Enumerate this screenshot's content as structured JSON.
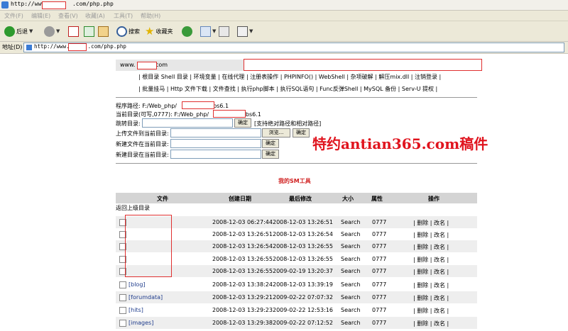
{
  "window": {
    "title_prefix": "http://www.",
    "title_suffix": ".com/php.php"
  },
  "menu": [
    "文件(F)",
    "编辑(E)",
    "查看(V)",
    "收藏(A)",
    "工具(T)",
    "帮助(H)"
  ],
  "toolbar": {
    "back": "后退",
    "search": "搜索",
    "favorites": "收藏夹"
  },
  "address": {
    "label": "地址(D)",
    "url_prefix": "http://www.",
    "url_suffix": ".com/php.php"
  },
  "site": {
    "label_prefix": "www.",
    "label_suffix": ".com"
  },
  "nav": {
    "line1": "| 根目录 Shell 目录 | 环境变量 | 在线代理 | 注册表操作 | PHPINFO() | WebShell | 杂项破解 | 解压mix.dll | 注销登录 |",
    "line2": "| 批量挂马 | Http 文件下载 | 文件查找 | 执行php脚本 | 执行SQL语句 | Func反弹Shell | MySQL 备份 | Serv-U 提权 |"
  },
  "paths": {
    "program_label": "程序路径: F:/Web_php/",
    "program_suffix": "bbs6.1",
    "current_label": "当前目录(可写,0777): F:/Web_php/",
    "current_suffix": "/bbs6.1",
    "jump_label": "跳转目录:",
    "jump_btn": "确定",
    "jump_hint": "[支持绝对路径和相对路径]",
    "upload_label": "上传文件到当前目录:",
    "browse_btn": "浏览...",
    "upload_btn": "确定",
    "newfile_label": "新建文件在当前目录:",
    "newfile_btn": "确定",
    "newdir_label": "新建目录在当前目录:",
    "newdir_btn": "确定"
  },
  "watermark": "特约antian365.com稿件",
  "tool_title": "我的SM工具",
  "table": {
    "headers": [
      "文件",
      "创建日期",
      "最后修改",
      "大小",
      "属性",
      "操作"
    ],
    "parent": "返回上级目录",
    "rows": [
      {
        "name": "",
        "created": "2008-12-03 06:27:44",
        "modified": "2008-12-03 13:26:51",
        "size": "Search",
        "attr": "0777",
        "ops": "| 删除 | 改名 |"
      },
      {
        "name": "",
        "created": "2008-12-03 13:26:51",
        "modified": "2008-12-03 13:26:54",
        "size": "Search",
        "attr": "0777",
        "ops": "| 删除 | 改名 |"
      },
      {
        "name": "",
        "created": "2008-12-03 13:26:54",
        "modified": "2008-12-03 13:26:55",
        "size": "Search",
        "attr": "0777",
        "ops": "| 删除 | 改名 |"
      },
      {
        "name": "",
        "created": "2008-12-03 13:26:55",
        "modified": "2008-12-03 13:26:55",
        "size": "Search",
        "attr": "0777",
        "ops": "| 删除 | 改名 |"
      },
      {
        "name": "",
        "created": "2008-12-03 13:26:55",
        "modified": "2009-02-19 13:20:37",
        "size": "Search",
        "attr": "0777",
        "ops": "| 删除 | 改名 |"
      },
      {
        "name": "[blog]",
        "created": "2008-12-03 13:38:24",
        "modified": "2008-12-03 13:39:19",
        "size": "Search",
        "attr": "0777",
        "ops": "| 删除 | 改名 |"
      },
      {
        "name": "[forumdata]",
        "created": "2008-12-03 13:29:21",
        "modified": "2009-02-22 07:07:32",
        "size": "Search",
        "attr": "0777",
        "ops": "| 删除 | 改名 |"
      },
      {
        "name": "[hits]",
        "created": "2008-12-03 13:29:23",
        "modified": "2009-02-22 12:53:16",
        "size": "Search",
        "attr": "0777",
        "ops": "| 删除 | 改名 |"
      },
      {
        "name": "[images]",
        "created": "2008-12-03 13:29:38",
        "modified": "2009-02-22 07:12:52",
        "size": "Search",
        "attr": "0777",
        "ops": "| 删除 | 改名 |"
      }
    ]
  }
}
